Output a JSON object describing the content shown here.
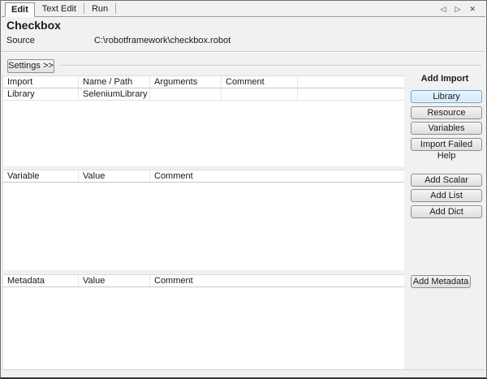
{
  "window": {
    "tabs": [
      {
        "label": "Edit"
      },
      {
        "label": "Text Edit"
      },
      {
        "label": "Run"
      }
    ],
    "nav": {
      "prev_icon": "◁",
      "next_icon": "▷",
      "close_icon": "✕"
    }
  },
  "header": {
    "title": "Checkbox",
    "source_label": "Source",
    "source_path": "C:\\robotframework\\checkbox.robot"
  },
  "settings": {
    "toggle_label": "Settings >>"
  },
  "import_table": {
    "headers": [
      "Import",
      "Name / Path",
      "Arguments",
      "Comment",
      ""
    ],
    "rows": [
      {
        "type": "Library",
        "name": "SeleniumLibrary",
        "args": "",
        "comment": ""
      }
    ]
  },
  "variable_table": {
    "headers": [
      "Variable",
      "Value",
      "Comment"
    ],
    "rows": []
  },
  "metadata_table": {
    "headers": [
      "Metadata",
      "Value",
      "Comment"
    ],
    "rows": []
  },
  "sidebar": {
    "add_import_label": "Add Import",
    "buttons": {
      "library": "Library",
      "resource": "Resource",
      "variables": "Variables",
      "import_failed_help": "Import Failed Help",
      "add_scalar": "Add Scalar",
      "add_list": "Add List",
      "add_dict": "Add Dict",
      "add_metadata": "Add Metadata"
    },
    "focused_button": "Library"
  },
  "colors": {
    "focus_border": "#66a7d8",
    "focus_bg": "#ddeefb",
    "panel_bg": "#f1f1f1"
  }
}
